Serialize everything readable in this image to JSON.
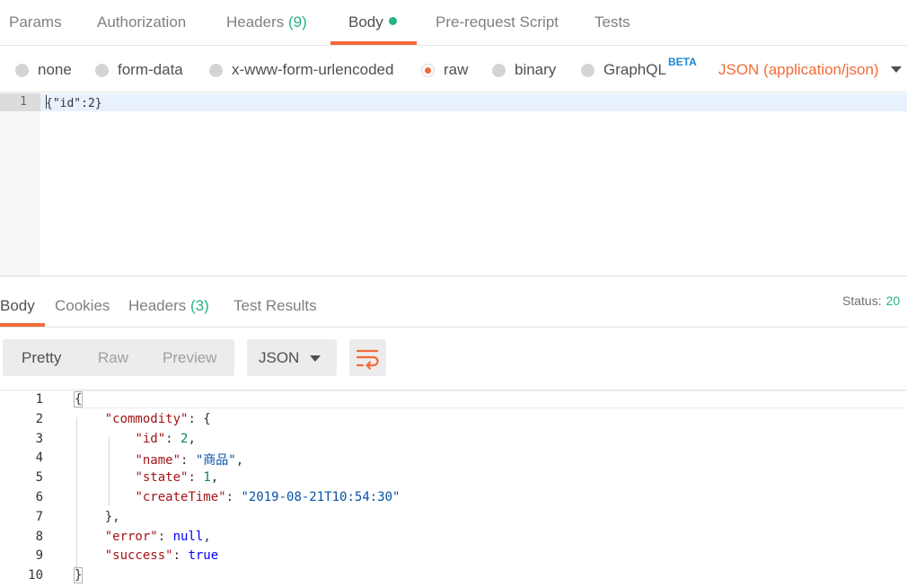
{
  "request_tabs": [
    {
      "label": "Params"
    },
    {
      "label": "Authorization"
    },
    {
      "label": "Headers",
      "count": "(9)"
    },
    {
      "label": "Body"
    },
    {
      "label": "Pre-request Script"
    },
    {
      "label": "Tests"
    }
  ],
  "body_types": [
    {
      "label": "none"
    },
    {
      "label": "form-data"
    },
    {
      "label": "x-www-form-urlencoded"
    },
    {
      "label": "raw",
      "selected": true
    },
    {
      "label": "binary"
    },
    {
      "label": "GraphQL"
    }
  ],
  "beta_badge": "BETA",
  "content_type": "JSON (application/json)",
  "request_editor": {
    "line_number": "1",
    "code": "{\"id\":2}"
  },
  "response_tabs": [
    {
      "label": "Body"
    },
    {
      "label": "Cookies"
    },
    {
      "label": "Headers",
      "count": "(3)"
    },
    {
      "label": "Test Results"
    }
  ],
  "status": {
    "label": "Status:",
    "value": "20"
  },
  "view_modes": [
    {
      "label": "Pretty"
    },
    {
      "label": "Raw"
    },
    {
      "label": "Preview"
    }
  ],
  "format": "JSON",
  "response_lines": [
    {
      "n": "1",
      "text": "{"
    },
    {
      "n": "2",
      "key": "\"commodity\"",
      "rest": ": {"
    },
    {
      "n": "3",
      "key": "\"id\"",
      "rest": ": ",
      "num": "2",
      "tail": ","
    },
    {
      "n": "4",
      "key": "\"name\"",
      "rest": ": ",
      "str": "\"商品\"",
      "tail": ","
    },
    {
      "n": "5",
      "key": "\"state\"",
      "rest": ": ",
      "num": "1",
      "tail": ","
    },
    {
      "n": "6",
      "key": "\"createTime\"",
      "rest": ": ",
      "str": "\"2019-08-21T10:54:30\"",
      "tail": ""
    },
    {
      "n": "7",
      "text": "},"
    },
    {
      "n": "8",
      "key": "\"error\"",
      "rest": ": ",
      "kw": "null",
      "tail": ","
    },
    {
      "n": "9",
      "key": "\"success\"",
      "rest": ": ",
      "kw": "true",
      "tail": ""
    },
    {
      "n": "10",
      "text": "}"
    }
  ],
  "colors": {
    "accent": "#f26b3a",
    "count_green": "#26b47f",
    "beta_blue": "#1a86d4"
  }
}
